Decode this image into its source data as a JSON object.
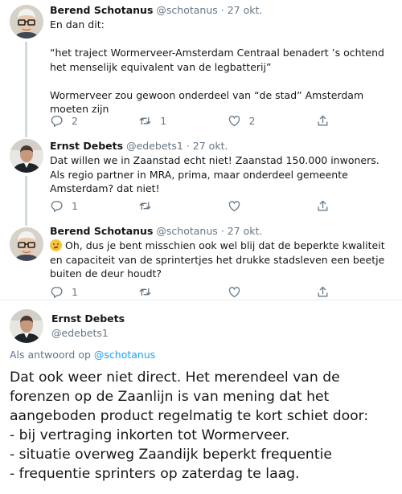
{
  "tweets": [
    {
      "name": "Berend Schotanus",
      "handle": "@schotanus",
      "date": "27 okt.",
      "paragraphs": [
        "En dan dit:",
        "“het traject Wormerveer-Amsterdam Centraal benadert ’s ochtend het menselijk equivalent van de legbatterij”",
        "Wormerveer zou gewoon onderdeel van “de stad” Amsterdam moeten zijn"
      ],
      "reply_count": "2",
      "retweet_count": "1",
      "like_count": "2"
    },
    {
      "name": "Ernst Debets",
      "handle": "@edebets1",
      "date": "27 okt.",
      "text": "Dat willen we in Zaanstad echt niet! Zaanstad 150.000 inwoners. Als regio partner in MRA, prima, maar onderdeel gemeente Amsterdam? dat niet!",
      "reply_count": "1",
      "retweet_count": "",
      "like_count": ""
    },
    {
      "name": "Berend Schotanus",
      "handle": "@schotanus",
      "date": "27 okt.",
      "emoji": "thinking-face",
      "text": "Oh, dus je bent misschien ook wel blij dat de beperkte kwaliteit en capaciteit van de sprintertjes het drukke stadsleven een beetje buiten de deur houdt?",
      "reply_count": "1",
      "retweet_count": "",
      "like_count": ""
    }
  ],
  "focused": {
    "name": "Ernst Debets",
    "handle": "@edebets1",
    "reply_prefix": "Als antwoord op ",
    "reply_handle": "@schotanus",
    "lines": [
      "Dat ook weer niet direct. Het merendeel van de",
      "forenzen op de Zaanlijn is van mening dat het",
      "aangeboden product regelmatig te kort schiet door:",
      "- bij vertraging inkorten tot Wormerveer.",
      "- situatie overweg Zaandijk beperkt frequentie",
      "- frequentie sprinters op zaterdag te laag."
    ]
  },
  "separator": " · ",
  "icons": {
    "reply": "reply-icon",
    "retweet": "retweet-icon",
    "like": "heart-icon",
    "share": "share-icon"
  },
  "colors": {
    "link": "#1da1f2",
    "secondary": "#657786",
    "divider": "#e6ecf0"
  }
}
